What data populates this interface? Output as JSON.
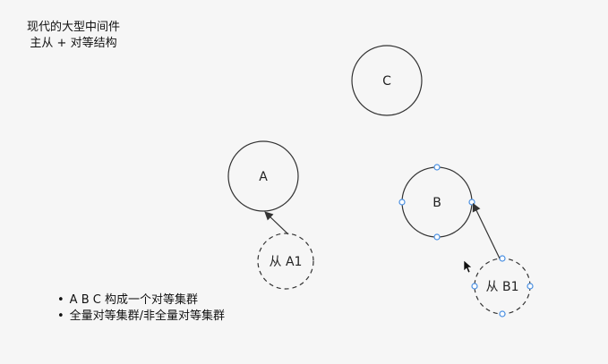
{
  "header": {
    "line1": "现代的大型中间件",
    "line2": "主从 + 对等结构"
  },
  "nodes": {
    "c": "C",
    "a": "A",
    "b": "B",
    "a1": "从 A1",
    "b1": "从 B1"
  },
  "notes": [
    "A B C 构成一个对等集群",
    "全量对等集群/非全量对等集群"
  ],
  "colors": {
    "stroke": "#333333",
    "handle": "#4a90e2",
    "background": "#f6f6f6"
  }
}
